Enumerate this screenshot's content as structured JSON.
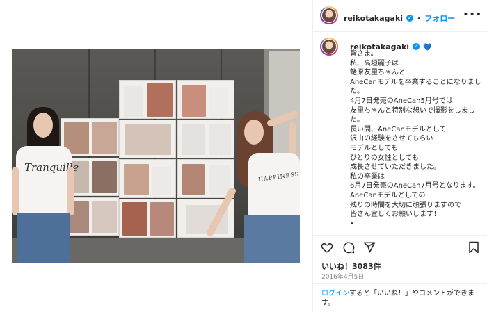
{
  "post": {
    "image_alt": "",
    "tshirt_left_text": "Tranquille",
    "tshirt_right_text": "HAPPINESS"
  },
  "header": {
    "username": "reikotakagaki",
    "dot": "•",
    "follow_label": "フォロー",
    "more": "•••"
  },
  "caption": {
    "username": "reikotakagaki",
    "heart": "💙",
    "text": "皆さま。\n私、高垣麗子は\n蛯原友里ちゃんと\nAneCanモデルを卒業することになりました。\n4月7日発売のAneCan5月号では\n友里ちゃんと特別な想いで撮影をしました。\n長い間、AneCanモデルとして\n沢山の経験をさせてもらい\nモデルとしても\nひとりの女性としても\n成長させていただきました。\n私の卒業は\n6月7日発売のAneCan7月号となります。\nAneCanモデルとしての\n残りの時間を大切に頑張りますので\n皆さん宜しくお願いします！\n•"
  },
  "actions": {
    "like_icon": "heart-icon",
    "comment_icon": "comment-icon",
    "share_icon": "share-icon",
    "save_icon": "bookmark-icon"
  },
  "likes_text": "いいね！3083件",
  "date_text": "2016年4月5日",
  "footer": {
    "login_link": "ログイン",
    "rest": "すると「いいね！」やコメントができます。"
  },
  "colors": {
    "accent": "#0095f6",
    "text": "#262626",
    "muted": "#8e8e8e"
  }
}
